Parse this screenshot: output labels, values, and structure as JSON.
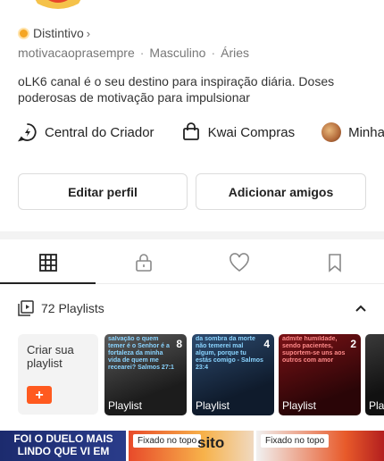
{
  "colors": {
    "accent": "#ff5a1f",
    "badge": "#f5a623",
    "text": "#222222",
    "muted": "#777777"
  },
  "profile": {
    "badge_label": "Distintivo",
    "meta": [
      "motivacaoprasempre",
      "Masculino",
      "Áries"
    ],
    "meta_separator": "·",
    "bio": "oLK6  canal  é o seu destino para inspiração diária. Doses poderosas de motivação para impulsionar"
  },
  "links": [
    {
      "label": "Central do Criador",
      "icon": "lightning-bolt-icon"
    },
    {
      "label": "Kwai Compras",
      "icon": "shopping-bag-icon"
    },
    {
      "label": "Minha f",
      "icon": "avatar-icon"
    }
  ],
  "actions": {
    "edit": "Editar perfil",
    "add_friends": "Adicionar amigos"
  },
  "tabs": [
    {
      "name": "grid",
      "icon": "grid-icon",
      "active": true
    },
    {
      "name": "private",
      "icon": "lock-icon",
      "active": false
    },
    {
      "name": "liked",
      "icon": "heart-icon",
      "active": false
    },
    {
      "name": "saved",
      "icon": "bookmark-icon",
      "active": false
    }
  ],
  "playlists": {
    "count_label": "72 Playlists",
    "create_label": "Criar sua playlist",
    "create_button": "+",
    "items": [
      {
        "overlay": "salvação o quem temer é o Senhor é a fortaleza da minha vida de quem me recearei? Salmos 27:1",
        "count": "8",
        "label": "Playlist"
      },
      {
        "overlay": "da sombra da morte não temerei mal algum, porque tu estás comigo - Salmos 23:4",
        "count": "4",
        "label": "Playlist"
      },
      {
        "overlay": "admite humildade, sendo pacientes, suportem-se uns aos outros com amor",
        "count": "2",
        "label": "Playlist"
      },
      {
        "overlay": "",
        "count": "",
        "label": "Pla"
      }
    ]
  },
  "videos": [
    {
      "title": "FOI O DUELO MAIS LINDO QUE VI EM",
      "pinned": ""
    },
    {
      "title": "sito",
      "pinned": "Fixado no topo"
    },
    {
      "title": "",
      "pinned": "Fixado no topo"
    }
  ]
}
